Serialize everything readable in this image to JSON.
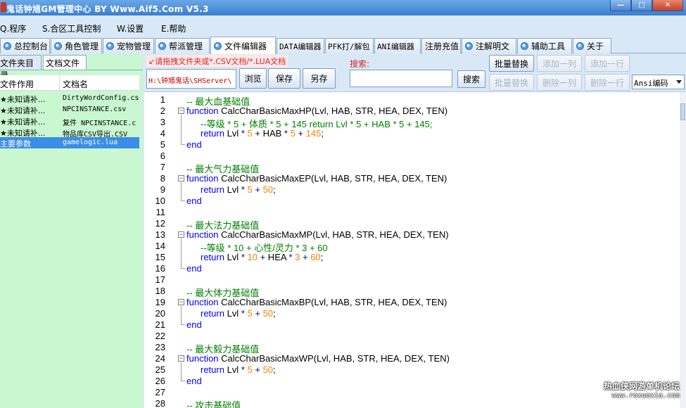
{
  "window": {
    "title": "鬼话钟馗GM管理中心 BY Www.Aif5.Com  V5.3",
    "minimize": "—",
    "maximize": "□",
    "close": "✕"
  },
  "menu": [
    "Q.程序",
    "S.合区工具控制",
    "W.设置",
    "E.帮助"
  ],
  "tabs": [
    "总控制台",
    "角色管理",
    "宠物管理",
    "帮派管理",
    "文件编辑器",
    "DATA编辑器",
    "PFK打/解包",
    "ANI编辑器",
    "注册充值",
    "注解明文",
    "辅助工具",
    "关于"
  ],
  "left_panel": {
    "tabs": [
      "文件夹目录",
      "文档文件"
    ],
    "columns": [
      "文件作用",
      "文档名"
    ],
    "rows": [
      {
        "purpose": "★未知请补...",
        "name": "DirtyWordConfig.cs"
      },
      {
        "purpose": "★未知请补...",
        "name": "NPCINSTANCE.csv"
      },
      {
        "purpose": "★未知请补...",
        "name": "复件 NPCINSTANCE.c"
      },
      {
        "purpose": "★未知请补...",
        "name": "物品库CSV导出.CSV"
      },
      {
        "purpose": "主要参数",
        "name": "gamelogic.lua"
      }
    ]
  },
  "toolbar": {
    "hint": "↙请拖拽文件夹或*.CSV文档/*.LUA文档",
    "path": "H:\\钟馗鬼话\\SHServer\\",
    "browse": "浏览",
    "save": "保存",
    "save_as": "另存",
    "search_label": "搜索:",
    "search_value": "",
    "search_button": "搜索",
    "batch_replace_1": "批量替换",
    "batch_replace_2": "批量替换",
    "add_column": "添加一列",
    "delete_column": "删除一列",
    "add_row": "添加一行",
    "delete_row": "删除一行",
    "encoding": "Ansi编码"
  },
  "code_lines": [
    {
      "n": "1",
      "text": "-- 最大血基础值"
    },
    {
      "n": "2",
      "text": "function CalcCharBasicMaxHP(Lvl, HAB, STR, HEA, DEX, TEN)"
    },
    {
      "n": "3",
      "text": "--等级 * 5 + 体质 * 5 + 145 return Lvl * 5 + HAB * 5 + 145;"
    },
    {
      "n": "4",
      "text": "return Lvl * 5 + HAB * 5 + 145;"
    },
    {
      "n": "5",
      "text": "end"
    },
    {
      "n": "6",
      "text": ""
    },
    {
      "n": "7",
      "text": "-- 最大气力基础值"
    },
    {
      "n": "8",
      "text": "function CalcCharBasicMaxEP(Lvl, HAB, STR, HEA, DEX, TEN)"
    },
    {
      "n": "9",
      "text": "return Lvl * 5 + 50;"
    },
    {
      "n": "10",
      "text": "end"
    },
    {
      "n": "11",
      "text": ""
    },
    {
      "n": "12",
      "text": "-- 最大法力基础值"
    },
    {
      "n": "13",
      "text": "function CalcCharBasicMaxMP(Lvl, HAB, STR, HEA, DEX, TEN)"
    },
    {
      "n": "14",
      "text": "--等级 * 10 + 心性/灵力 * 3 + 60"
    },
    {
      "n": "15",
      "text": "return Lvl * 10 + HEA * 3 + 60;"
    },
    {
      "n": "16",
      "text": "end"
    },
    {
      "n": "17",
      "text": ""
    },
    {
      "n": "18",
      "text": "-- 最大体力基础值"
    },
    {
      "n": "19",
      "text": "function CalcCharBasicMaxBP(Lvl, HAB, STR, HEA, DEX, TEN)"
    },
    {
      "n": "20",
      "text": "return Lvl * 5 + 50;"
    },
    {
      "n": "21",
      "text": "end"
    },
    {
      "n": "22",
      "text": ""
    },
    {
      "n": "23",
      "text": "-- 最大毅力基础值"
    },
    {
      "n": "24",
      "text": "function CalcCharBasicMaxWP(Lvl, HAB, STR, HEA, DEX, TEN)"
    },
    {
      "n": "25",
      "text": "return Lvl * 5 + 50;"
    },
    {
      "n": "26",
      "text": "end"
    },
    {
      "n": "27",
      "text": ""
    },
    {
      "n": "28",
      "text": "-- 攻击基础值"
    }
  ],
  "watermark": {
    "line1": "热血侠网游单机论坛",
    "line2": "www.rexuexia.com"
  }
}
